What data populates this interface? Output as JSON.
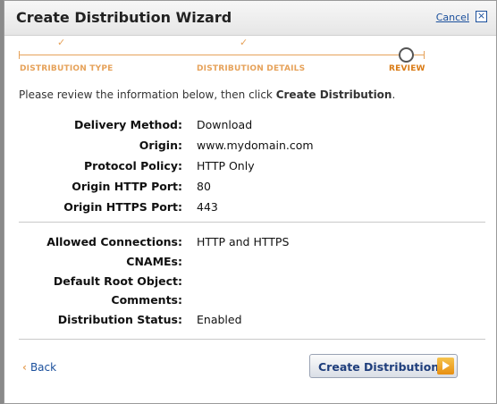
{
  "dialog": {
    "title": "Create Distribution Wizard",
    "cancel_label": "Cancel",
    "close_glyph": "×"
  },
  "steps": [
    {
      "label": "DISTRIBUTION TYPE",
      "status": "complete"
    },
    {
      "label": "DISTRIBUTION DETAILS",
      "status": "complete"
    },
    {
      "label": "REVIEW",
      "status": "current"
    }
  ],
  "check_glyph": "✓",
  "intro": {
    "text": "Please review the information below, then click ",
    "bold": "Create Distribution",
    "end": "."
  },
  "details": [
    {
      "label": "Delivery Method:",
      "value": "Download"
    },
    {
      "label": "Origin:",
      "value": "www.mydomain.com"
    },
    {
      "label": "Protocol Policy:",
      "value": "HTTP Only"
    },
    {
      "label": "Origin HTTP Port:",
      "value": "80"
    },
    {
      "label": "Origin HTTPS Port:",
      "value": "443"
    }
  ],
  "settings": [
    {
      "label": "Allowed Connections:",
      "value": "HTTP and HTTPS"
    },
    {
      "label": "CNAMEs:",
      "value": ""
    },
    {
      "label": "Default Root Object:",
      "value": ""
    },
    {
      "label": "Comments:",
      "value": ""
    },
    {
      "label": "Distribution Status:",
      "value": "Enabled"
    }
  ],
  "footer": {
    "back_chevron": "‹",
    "back_label": "Back",
    "create_label": "Create Distribution"
  },
  "colors": {
    "accent_orange": "#e6a25a",
    "link_blue": "#1a4f9c"
  }
}
